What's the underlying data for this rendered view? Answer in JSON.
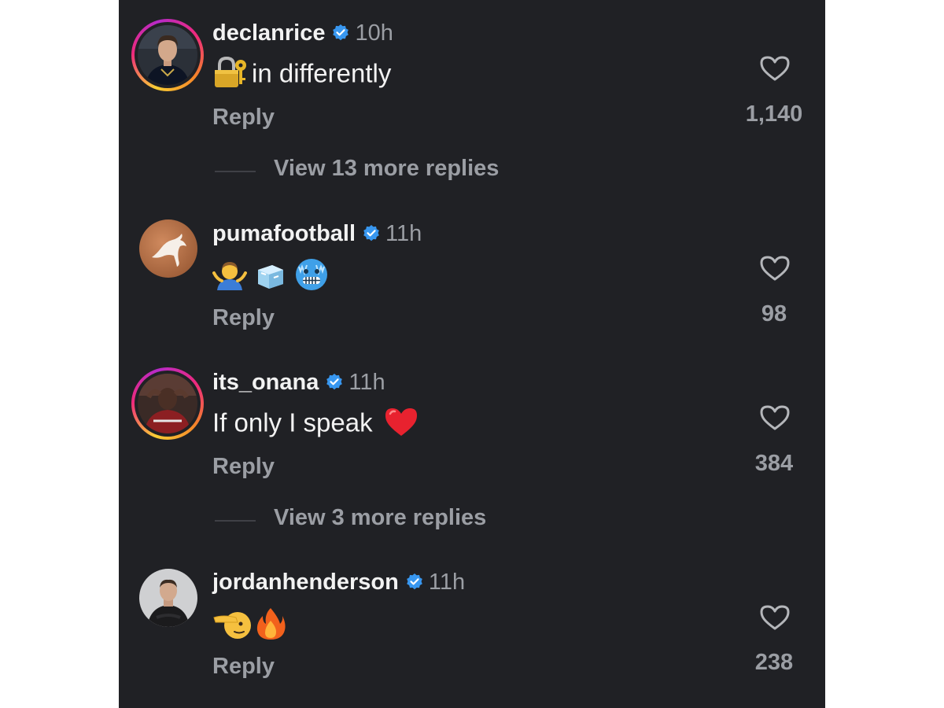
{
  "comments": [
    {
      "username": "declanrice",
      "time": "10h",
      "text": "in differently",
      "emoji_icons": [
        "lock-with-key-icon"
      ],
      "reply_label": "Reply",
      "likes": "1,140",
      "view_more": "View 13 more replies",
      "story_ring": true
    },
    {
      "username": "pumafootball",
      "time": "11h",
      "text": "",
      "emoji_icons": [
        "man-shrugging-icon",
        "ice-cube-icon",
        "freezing-face-icon"
      ],
      "reply_label": "Reply",
      "likes": "98",
      "story_ring": false
    },
    {
      "username": "its_onana",
      "time": "11h",
      "text": "If only I speak",
      "emoji_icons": [
        "red-heart-icon"
      ],
      "reply_label": "Reply",
      "likes": "384",
      "view_more": "View 3 more replies",
      "story_ring": true
    },
    {
      "username": "jordanhenderson",
      "time": "11h",
      "text": "",
      "emoji_icons": [
        "saluting-face-icon",
        "fire-icon"
      ],
      "reply_label": "Reply",
      "likes": "238",
      "story_ring": false
    }
  ],
  "colors": {
    "background": "#202125",
    "text_primary": "#f2f2f2",
    "text_secondary": "#9b9ea4",
    "verified_blue": "#3897f0"
  }
}
